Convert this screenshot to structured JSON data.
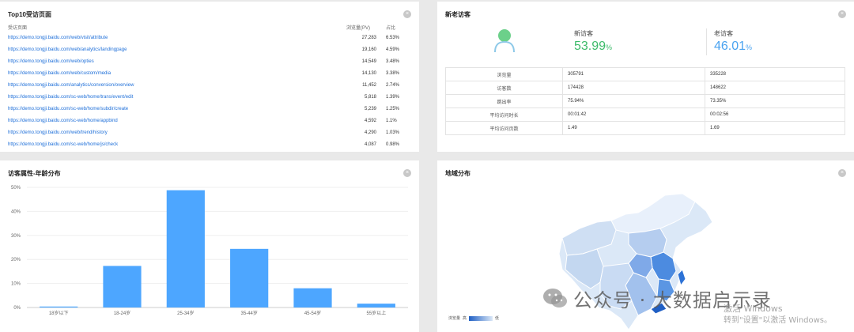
{
  "top_pages": {
    "title": "Top10受访页面",
    "col_page": "受访页面",
    "col_pv": "浏览量(PV)",
    "col_ratio": "占比",
    "rows": [
      {
        "url": "https://demo.tongji.baidu.com/web/visit/attribute",
        "pv": "27,283",
        "ratio": "6.53%"
      },
      {
        "url": "https://demo.tongji.baidu.com/web/analytics/landingpage",
        "pv": "19,160",
        "ratio": "4.59%"
      },
      {
        "url": "https://demo.tongji.baidu.com/web/opties",
        "pv": "14,549",
        "ratio": "3.48%"
      },
      {
        "url": "https://demo.tongji.baidu.com/web/custom/media",
        "pv": "14,130",
        "ratio": "3.38%"
      },
      {
        "url": "https://demo.tongji.baidu.com/analytics/conversion/overview",
        "pv": "11,452",
        "ratio": "2.74%"
      },
      {
        "url": "https://demo.tongji.baidu.com/sc-web/home/trans/event/edit",
        "pv": "5,818",
        "ratio": "1.39%"
      },
      {
        "url": "https://demo.tongji.baidu.com/sc-web/home/subdir/create",
        "pv": "5,239",
        "ratio": "1.25%"
      },
      {
        "url": "https://demo.tongji.baidu.com/sc-web/home/appbind",
        "pv": "4,592",
        "ratio": "1.1%"
      },
      {
        "url": "https://demo.tongji.baidu.com/web/trend/history",
        "pv": "4,290",
        "ratio": "1.03%"
      },
      {
        "url": "https://demo.tongji.baidu.com/sc-web/home/js/check",
        "pv": "4,087",
        "ratio": "0.98%"
      }
    ]
  },
  "visitors": {
    "title": "新老访客",
    "new_label": "新访客",
    "new_pct": "53.99",
    "old_label": "老访客",
    "old_pct": "46.01",
    "pct_sign": "%",
    "new_color": "#3dbb6a",
    "old_color": "#4aa3f0",
    "rows": [
      {
        "label": "浏览量",
        "new": "305791",
        "old": "335228"
      },
      {
        "label": "访客数",
        "new": "174428",
        "old": "148622"
      },
      {
        "label": "跳出率",
        "new": "75.94%",
        "old": "73.35%"
      },
      {
        "label": "平均访问时长",
        "new": "00:01:42",
        "old": "00:02:56"
      },
      {
        "label": "平均访问页数",
        "new": "1.49",
        "old": "1.69"
      }
    ]
  },
  "age": {
    "title": "访客属性-年龄分布",
    "bar_color": "#4da6ff"
  },
  "chart_data": {
    "type": "bar",
    "categories": [
      "18岁以下",
      "18-24岁",
      "25-34岁",
      "35-44岁",
      "45-54岁",
      "55岁以上"
    ],
    "values": [
      0.4,
      17.3,
      48.8,
      24.4,
      8.0,
      1.6
    ],
    "ylim": [
      0,
      50
    ],
    "ytick_labels": [
      "0%",
      "10%",
      "20%",
      "30%",
      "40%",
      "50%"
    ],
    "grid": true
  },
  "region": {
    "title": "地域分布",
    "legend_label": "浏览量",
    "legend_high": "高",
    "legend_low": "低"
  },
  "watermark": {
    "channel": "公众号 · 大数据启示录",
    "activate_line1": "激活 Windows",
    "activate_line2": "转到\"设置\"以激活 Windows。"
  }
}
